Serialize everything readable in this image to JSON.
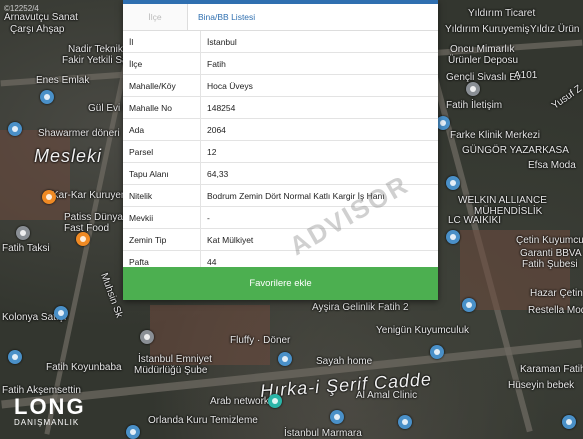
{
  "map": {
    "labels": [
      {
        "text": "Arnavutçu Sanat",
        "cls": ""
      },
      {
        "text": "Çarşı Ahşap",
        "cls": ""
      },
      {
        "text": "Nadir Teknik",
        "cls": ""
      },
      {
        "text": "Fakir Yetkili Satıcısı",
        "cls": ""
      },
      {
        "text": "Enes Emlak",
        "cls": ""
      },
      {
        "text": "Gül Evi Restoran",
        "cls": ""
      },
      {
        "text": "Shawarmer döneri",
        "cls": ""
      },
      {
        "text": "Mesleki",
        "cls": "big"
      },
      {
        "text": "Kar-Kar Kuruyemiş",
        "cls": ""
      },
      {
        "text": "Patiss Dünyası",
        "cls": ""
      },
      {
        "text": "Fast Food",
        "cls": ""
      },
      {
        "text": "Fatih Taksi",
        "cls": ""
      },
      {
        "text": "Muhsin Sk",
        "cls": ""
      },
      {
        "text": "Kolonya Satışı",
        "cls": ""
      },
      {
        "text": "Fatih Koyunbaba",
        "cls": ""
      },
      {
        "text": "Fatih Akşemsettin",
        "cls": ""
      },
      {
        "text": "Yıldırım Ticaret",
        "cls": ""
      },
      {
        "text": "Yıldırım Kuruyemiş",
        "cls": ""
      },
      {
        "text": "Yıldız Ürün",
        "cls": ""
      },
      {
        "text": "Oncu Mimarlık",
        "cls": ""
      },
      {
        "text": "Ürünler Deposu",
        "cls": ""
      },
      {
        "text": "Gençli Sivaslı Ev",
        "cls": ""
      },
      {
        "text": "Fatih İletişim",
        "cls": ""
      },
      {
        "text": "Farke Klinik Merkezi",
        "cls": ""
      },
      {
        "text": "GÜNGÖR YAZARKASA",
        "cls": ""
      },
      {
        "text": "Efsa Moda",
        "cls": ""
      },
      {
        "text": "WELKIN ALLIANCE",
        "cls": ""
      },
      {
        "text": "MÜHENDİSLİK",
        "cls": ""
      },
      {
        "text": "LC WAIKIKI",
        "cls": ""
      },
      {
        "text": "Çetin Kuyumculuk",
        "cls": ""
      },
      {
        "text": "Garanti BBVA",
        "cls": ""
      },
      {
        "text": "Fatih Şubesi",
        "cls": ""
      },
      {
        "text": "Hazar Çetin",
        "cls": ""
      },
      {
        "text": "Restella Moda",
        "cls": ""
      },
      {
        "text": "Yenigün Kuyumculuk",
        "cls": ""
      },
      {
        "text": "Ayşira Gelinlik Fatih 2",
        "cls": ""
      },
      {
        "text": "Fluffy · Döner",
        "cls": ""
      },
      {
        "text": "İstanbul Emniyet",
        "cls": ""
      },
      {
        "text": "Müdürlüğü Şube",
        "cls": ""
      },
      {
        "text": "Sayah home",
        "cls": ""
      },
      {
        "text": "Hırka-i Şerif Cadde",
        "cls": "big"
      },
      {
        "text": "Al Amal Clinic",
        "cls": ""
      },
      {
        "text": "Arab network",
        "cls": ""
      },
      {
        "text": "Orlanda Kuru Temizleme",
        "cls": ""
      },
      {
        "text": "İstanbul Marmara",
        "cls": ""
      },
      {
        "text": "Karaman Fatih",
        "cls": ""
      },
      {
        "text": "Hüseyin bebek",
        "cls": ""
      },
      {
        "text": "Yusuf Z",
        "cls": ""
      },
      {
        "text": "A101",
        "cls": ""
      }
    ],
    "copyright": "©12252/4",
    "logo_main": "LONG",
    "logo_sub": "DANIŞMANLIK"
  },
  "panel": {
    "tab_inactive": "İlçe",
    "tab_active": "Bina/BB Listesi",
    "rows": [
      {
        "key": "İl",
        "value": "İstanbul"
      },
      {
        "key": "İlçe",
        "value": "Fatih"
      },
      {
        "key": "Mahalle/Köy",
        "value": "Hoca Üveys"
      },
      {
        "key": "Mahalle No",
        "value": "148254"
      },
      {
        "key": "Ada",
        "value": "2064"
      },
      {
        "key": "Parsel",
        "value": "12"
      },
      {
        "key": "Tapu Alanı",
        "value": "64,33"
      },
      {
        "key": "Nitelik",
        "value": "Bodrum Zemin Dört Normal Katlı Kargir İş Hanı"
      },
      {
        "key": "Mevkii",
        "value": "-"
      },
      {
        "key": "Zemin Tip",
        "value": "Kat Mülkiyet"
      },
      {
        "key": "Pafta",
        "value": "44"
      }
    ],
    "favorite_label": "Favorilere ekle",
    "watermark": "ADVISOR"
  },
  "colors": {
    "accent": "#2f6fb0",
    "favorite_button": "#4caf50"
  }
}
